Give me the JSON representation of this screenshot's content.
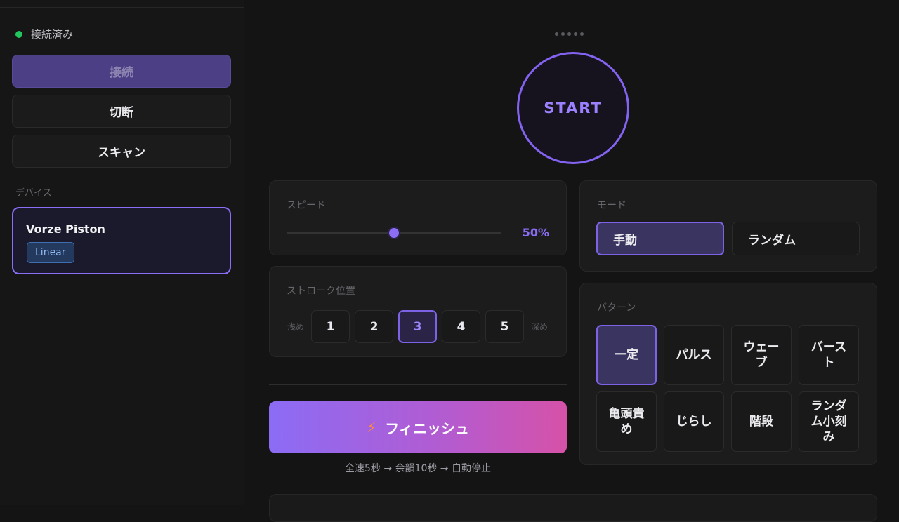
{
  "sidebar": {
    "status": {
      "label": "接続済み",
      "color": "#22c55e"
    },
    "buttons": {
      "connect": "接続",
      "disconnect": "切断",
      "scan": "スキャン"
    },
    "devices_label": "デバイス",
    "device": {
      "name": "Vorze Piston",
      "tag": "Linear"
    }
  },
  "main": {
    "start_label": "START",
    "speed": {
      "label": "スピード",
      "value": 0.5,
      "value_text": "50%"
    },
    "stroke": {
      "label": "ストローク位置",
      "shallow": "浅め",
      "deep": "深め",
      "positions": [
        "1",
        "2",
        "3",
        "4",
        "5"
      ],
      "selected": "3"
    },
    "finish": {
      "label": "フィニッシュ",
      "note": "全速5秒 → 余韻10秒 → 自動停止"
    },
    "mode": {
      "label": "モード",
      "options": [
        "手動",
        "ランダム"
      ],
      "selected": "手動"
    },
    "pattern": {
      "label": "パターン",
      "options": [
        "一定",
        "パルス",
        "ウェーブ",
        "バースト",
        "亀頭責め",
        "じらし",
        "階段",
        "ランダム小刻み"
      ],
      "selected": "一定"
    }
  },
  "colors": {
    "accent": "#8b6ef5",
    "finish_gradient_start": "#8b6cf5",
    "finish_gradient_end": "#d652a8"
  }
}
